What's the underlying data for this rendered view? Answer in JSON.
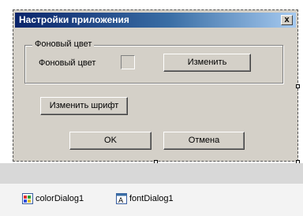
{
  "window": {
    "title": "Настройки приложения",
    "close_glyph": "x"
  },
  "groupbox": {
    "title": "Фоновый цвет",
    "label": "Фоновый цвет",
    "change_button": "Изменить"
  },
  "font_button": "Изменить шрифт",
  "ok_button": "OK",
  "cancel_button": "Отмена",
  "component_tray": {
    "items": [
      {
        "label": "colorDialog1",
        "icon": "color-dialog-icon"
      },
      {
        "label": "fontDialog1",
        "icon": "font-dialog-icon"
      }
    ]
  },
  "colors": {
    "titlebar_start": "#0a246a",
    "titlebar_end": "#a6caf0",
    "form_background": "#d4d0c8"
  }
}
